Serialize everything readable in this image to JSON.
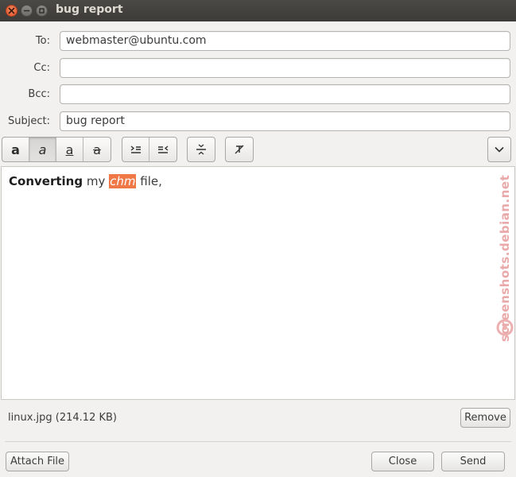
{
  "window": {
    "title": "bug report"
  },
  "header": {
    "to_label": "To:",
    "to_value": "webmaster@ubuntu.com",
    "cc_label": "Cc:",
    "cc_value": "",
    "bcc_label": "Bcc:",
    "bcc_value": "",
    "subject_label": "Subject:",
    "subject_value": "bug report"
  },
  "toolbar": {
    "bold_glyph": "a",
    "italic_glyph": "a",
    "underline_glyph": "a",
    "strike_glyph": "a",
    "italic_active": true
  },
  "editor": {
    "bold_text": "Converting",
    "text_before_highlight": " my ",
    "highlight_text": "chm",
    "text_after_highlight": " file,"
  },
  "watermark": "screenshots.debian.net",
  "attachment": {
    "name": "linux.jpg (214.12 KB)",
    "remove_label": "Remove"
  },
  "footer": {
    "attach_label": "Attach File",
    "close_label": "Close",
    "send_label": "Send"
  },
  "colors": {
    "highlight": "#f07746",
    "titlebar": "#3c3b37",
    "close_button": "#e0522b"
  }
}
